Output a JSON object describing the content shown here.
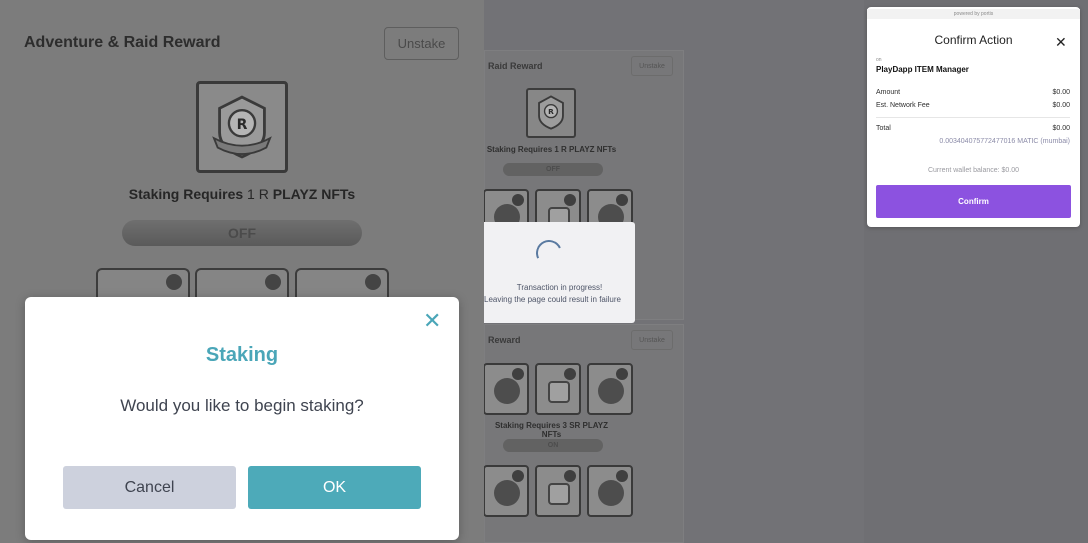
{
  "left_panel": {
    "title": "Adventure & Raid Reward",
    "unstake_label": "Unstake",
    "badge_letter": "R",
    "requires_prefix": "Staking Requires",
    "requires_count": "1 R",
    "requires_suffix": "PLAYZ NFTs",
    "toggle_label": "OFF"
  },
  "middle": {
    "card_a": {
      "title": "Raid Reward",
      "unstake_label": "Unstake",
      "badge_letter": "R",
      "requires": "Staking Requires 1 R PLAYZ NFTs",
      "toggle_label": "OFF"
    },
    "card_b": {
      "title": "Reward",
      "unstake_label": "Unstake",
      "requires": "Staking Requires 3 SR PLAYZ NFTs",
      "toggle_label": "ON"
    },
    "progress": {
      "line1": "Transaction in progress!",
      "line2": "Leaving the page could result in failure!"
    }
  },
  "confirm_action": {
    "powered_by": "powered by portis",
    "title": "Confirm Action",
    "on_label": "on",
    "dapp_name": "PlayDapp ITEM Manager",
    "amount_label": "Amount",
    "amount_value": "$0.00",
    "fee_label": "Est. Network Fee",
    "fee_value": "$0.00",
    "total_label": "Total",
    "total_value": "$0.00",
    "matic_value": "0.003404075772477016 MATIC (mumbai)",
    "balance_text": "Current wallet balance: $0.00",
    "confirm_label": "Confirm"
  },
  "staking_modal": {
    "title": "Staking",
    "question": "Would you like to begin staking?",
    "cancel_label": "Cancel",
    "ok_label": "OK"
  },
  "colors": {
    "accent_teal": "#4daab9",
    "portis_purple": "#8c52e0",
    "cancel_gray": "#cdd1dd"
  }
}
